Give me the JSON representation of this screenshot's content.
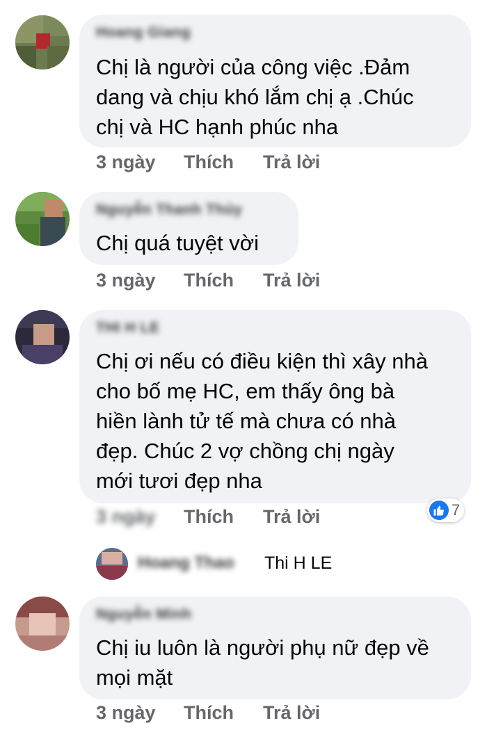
{
  "comments": [
    {
      "author": "Hoang Giang",
      "text": "Chị là người của công việc .Đảm\ndang và chịu khó lắm chị ạ .Chúc\nchị và HC hạnh phúc nha",
      "time": "3 ngày",
      "like_label": "Thích",
      "reply_label": "Trả lời"
    },
    {
      "author": "Nguyễn Thanh Thủy",
      "text": "Chị quá tuyệt vời",
      "time": "3 ngày",
      "like_label": "Thích",
      "reply_label": "Trả lời"
    },
    {
      "author": "THI H LE",
      "text": "Chị ơi nếu có điều kiện thì xây nhà\ncho bố mẹ HC, em thấy ông bà\nhiền lành tử tế mà chưa có nhà\nđẹp. Chúc 2 vợ chồng chị ngày\nmới tươi đẹp nha",
      "time": "3 ngày",
      "like_label": "Thích",
      "reply_label": "Trả lời",
      "reactions": {
        "icon": "like-icon",
        "count": "7",
        "color": "#1877f2"
      },
      "reply": {
        "author": "Hoang Thao",
        "mention": "Thi H LE"
      }
    },
    {
      "author": "Nguyễn Minh",
      "text": "Chị iu luôn là người phụ nữ đẹp về\nmọi mặt",
      "time": "3 ngày",
      "like_label": "Thích",
      "reply_label": "Trả lời"
    }
  ],
  "colors": {
    "bubble": "#f0f2f5",
    "action_text": "#65676b",
    "body_text": "#050505",
    "like_blue": "#1877f2"
  }
}
